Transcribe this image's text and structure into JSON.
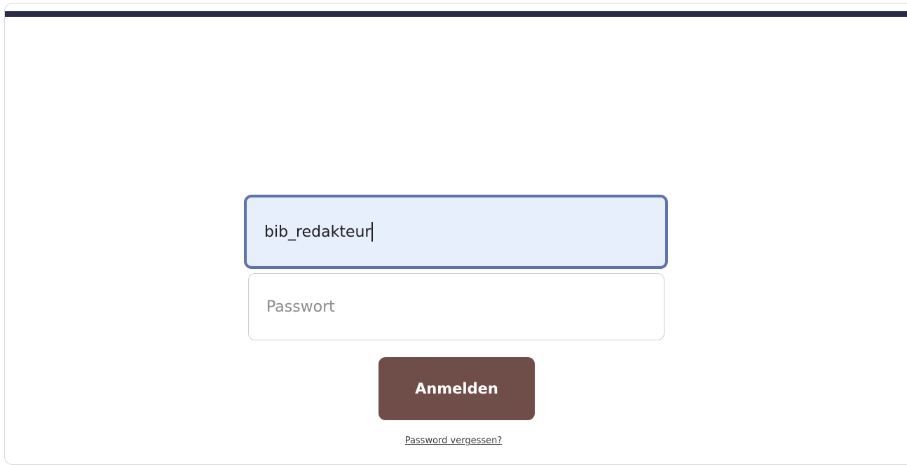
{
  "login": {
    "username_value": "bib_redakteur",
    "password_placeholder": "Passwort",
    "submit_label": "Anmelden",
    "forgot_link": "Password vergessen?"
  },
  "colors": {
    "top_bar": "#2a2b45",
    "username_bg": "#e8effc",
    "username_border": "#5e73a8",
    "button_bg": "#6f4d48",
    "button_text": "#ffffff"
  }
}
